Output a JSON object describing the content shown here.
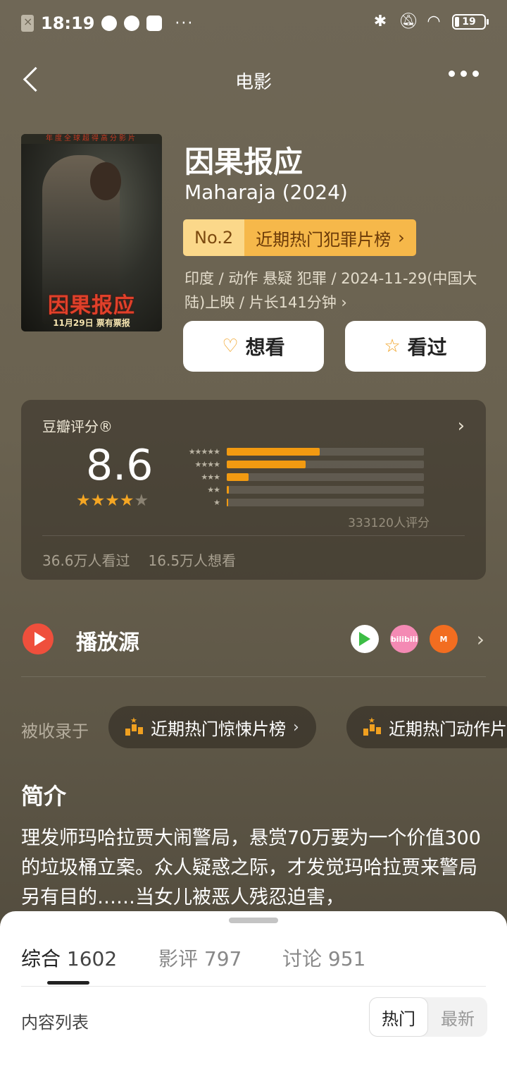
{
  "status_bar": {
    "time": "18:19",
    "more": "···",
    "battery": "19"
  },
  "nav": {
    "title": "电影"
  },
  "movie": {
    "title": "因果报应",
    "subtitle": "Maharaja (2024)",
    "rank_no": "No.2",
    "rank_list": "近期热门犯罪片榜",
    "meta": "印度 / 动作 悬疑 犯罪 / 2024-11-29(中国大陆)上映 / 片长141分钟",
    "poster": {
      "title": "因果报应",
      "date": "11月29日  票有票报",
      "top_text": "年度全球超得高分影片"
    }
  },
  "actions": {
    "want": "想看",
    "seen": "看过"
  },
  "rating": {
    "label": "豆瓣评分®",
    "score": "8.6",
    "stars": 4.5,
    "distribution_percent": [
      47,
      40,
      11,
      1,
      0.5
    ],
    "count_text": "333120人评分",
    "watched": "36.6万人看过",
    "wanted": "16.5万人想看",
    "accent_color": "#f29a11"
  },
  "play": {
    "label": "播放源",
    "platforms": [
      "tencent-video-icon",
      "bilibili-icon",
      "mango-tv-icon"
    ],
    "bili_text": "bilibili"
  },
  "collections": {
    "label": "被收录于",
    "items": [
      {
        "label": "近期热门惊悚片榜"
      },
      {
        "label": "近期热门动作片"
      }
    ]
  },
  "intro": {
    "title": "简介",
    "text": "理发师玛哈拉贾大闹警局，悬赏70万要为一个价值300的垃圾桶立案。众人疑惑之际，才发觉玛哈拉贾来警局另有目的……当女儿被恶人残忍迫害，"
  },
  "sheet": {
    "tabs": [
      {
        "label": "综合",
        "count": "1602"
      },
      {
        "label": "影评",
        "count": "797"
      },
      {
        "label": "讨论",
        "count": "951"
      }
    ],
    "content_label": "内容列表",
    "sort_hot": "热门",
    "sort_new": "最新"
  }
}
